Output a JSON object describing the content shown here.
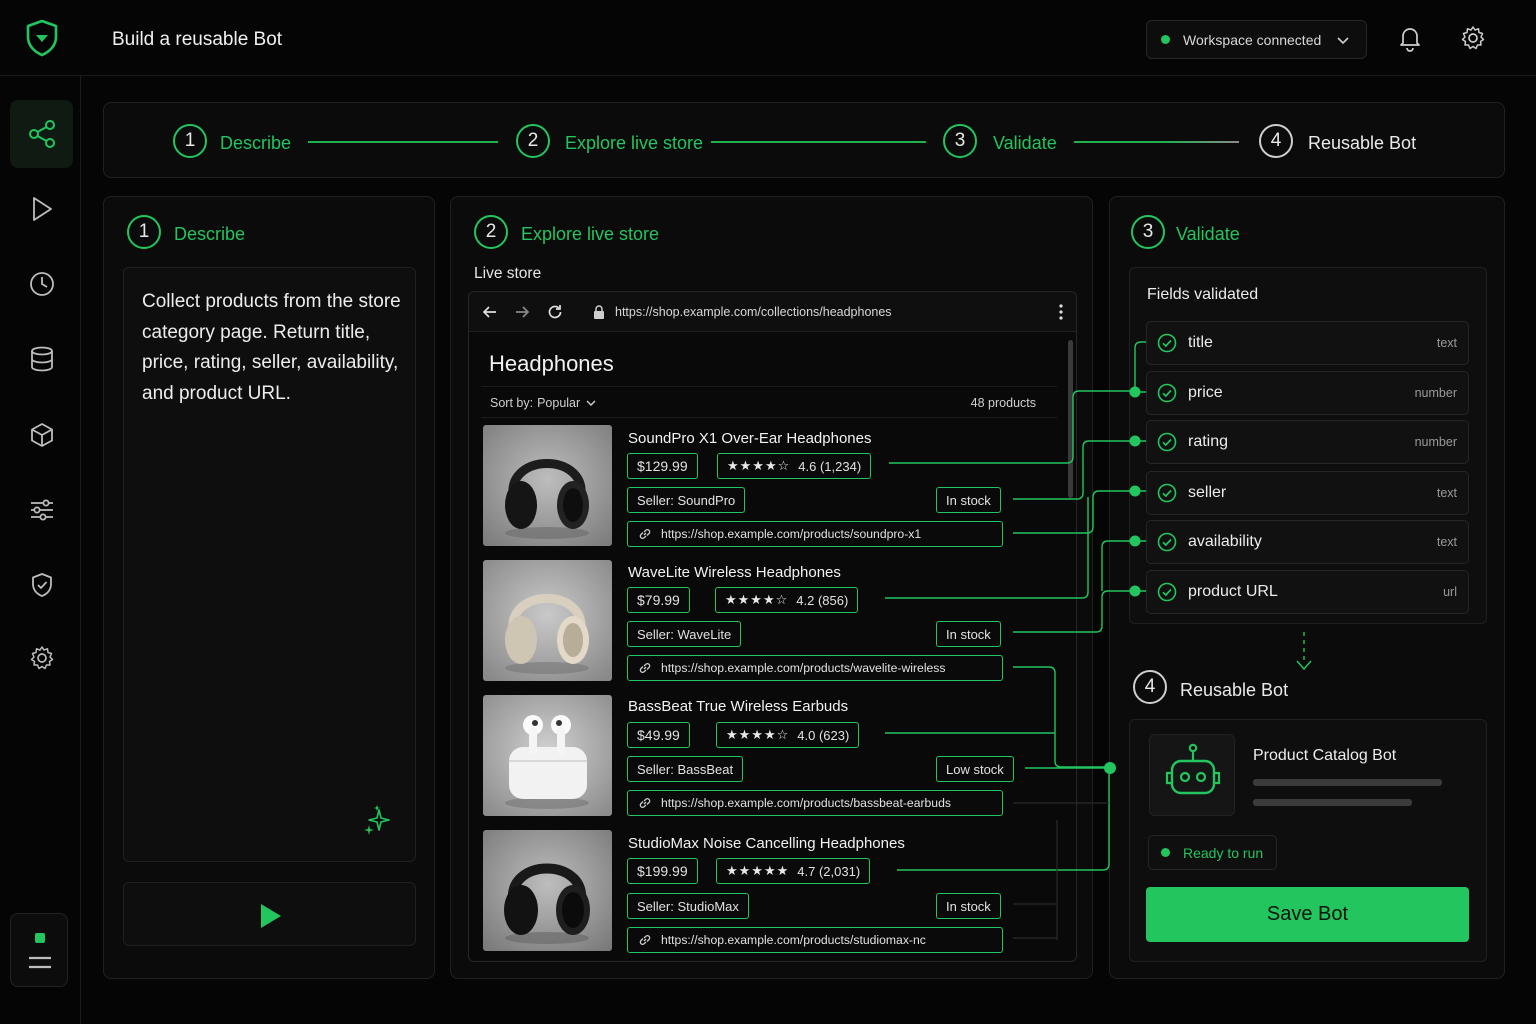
{
  "header": {
    "title": "Build a reusable Bot",
    "workspace_status": "Workspace connected"
  },
  "stepper": [
    {
      "num": "1",
      "label": "Describe"
    },
    {
      "num": "2",
      "label": "Explore live store"
    },
    {
      "num": "3",
      "label": "Validate"
    },
    {
      "num": "4",
      "label": "Reusable Bot"
    }
  ],
  "describe": {
    "num": "1",
    "title": "Describe",
    "prompt": "Collect products from the store category page. Return title, price, rating, seller, availability, and product URL."
  },
  "explore": {
    "num": "2",
    "title": "Explore live store",
    "subtitle": "Live store",
    "url": "https://shop.example.com/collections/headphones",
    "heading": "Headphones",
    "sort_label": "Sort by:",
    "sort_value": "Popular",
    "count": "48 products",
    "products": [
      {
        "title": "SoundPro X1 Over-Ear Headphones",
        "price": "$129.99",
        "stars": "★★★★☆",
        "rating": "4.6 (1,234)",
        "seller": "Seller: SoundPro",
        "stock": "In stock",
        "url": "https://shop.example.com/products/soundpro-x1"
      },
      {
        "title": "WaveLite Wireless Headphones",
        "price": "$79.99",
        "stars": "★★★★☆",
        "rating": "4.2 (856)",
        "seller": "Seller: WaveLite",
        "stock": "In stock",
        "url": "https://shop.example.com/products/wavelite-wireless"
      },
      {
        "title": "BassBeat True Wireless Earbuds",
        "price": "$49.99",
        "stars": "★★★★☆",
        "rating": "4.0 (623)",
        "seller": "Seller: BassBeat",
        "stock": "Low stock",
        "url": "https://shop.example.com/products/bassbeat-earbuds"
      },
      {
        "title": "StudioMax Noise Cancelling Headphones",
        "price": "$199.99",
        "stars": "★★★★★",
        "rating": "4.7 (2,031)",
        "seller": "Seller: StudioMax",
        "stock": "In stock",
        "url": "https://shop.example.com/products/studiomax-nc"
      }
    ]
  },
  "validate": {
    "num": "3",
    "title": "Validate",
    "box_title": "Fields validated",
    "fields": [
      {
        "name": "title",
        "type": "text"
      },
      {
        "name": "price",
        "type": "number"
      },
      {
        "name": "rating",
        "type": "number"
      },
      {
        "name": "seller",
        "type": "text"
      },
      {
        "name": "availability",
        "type": "text"
      },
      {
        "name": "product URL",
        "type": "url"
      }
    ]
  },
  "bot": {
    "num": "4",
    "title": "Reusable Bot",
    "name": "Product Catalog Bot",
    "status": "Ready to run",
    "save_label": "Save Bot"
  },
  "colors": {
    "accent": "#22c55e",
    "background": "#050505",
    "panel": "#0b0b0b"
  }
}
